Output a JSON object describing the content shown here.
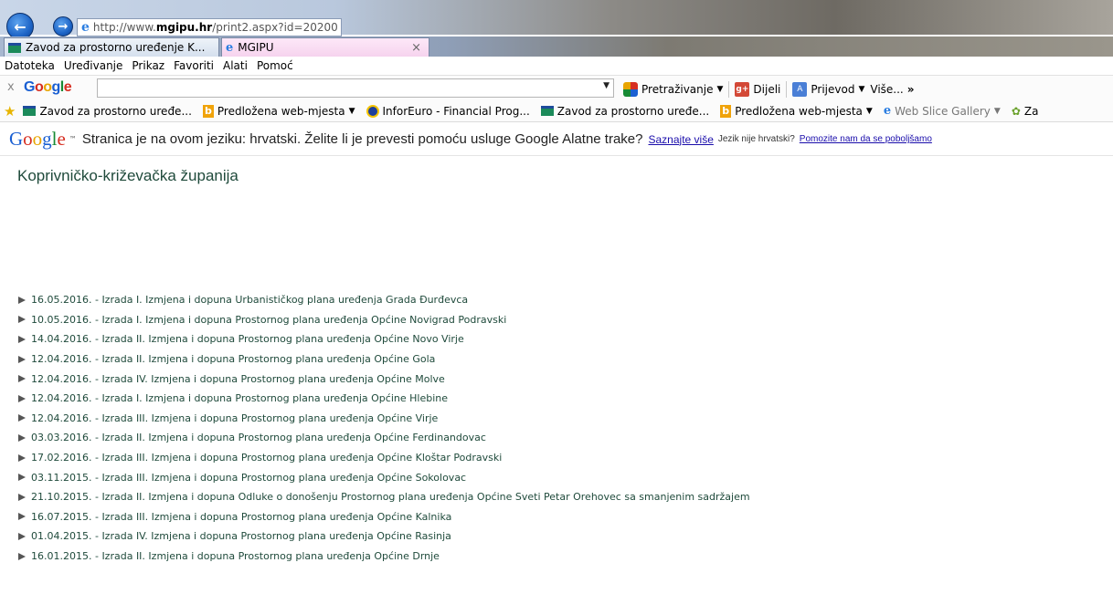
{
  "browser": {
    "url_prefix": "http://www.",
    "url_domain": "mgipu.hr",
    "url_path": "/print2.aspx?id=20200",
    "tabs": [
      {
        "label": "Zavod za prostorno uređenje K..."
      },
      {
        "label": "MGIPU"
      }
    ],
    "menu": [
      "Datoteka",
      "Uređivanje",
      "Prikaz",
      "Favoriti",
      "Alati",
      "Pomoć"
    ]
  },
  "google_toolbar": {
    "close": "x",
    "logo": [
      "G",
      "o",
      "o",
      "g",
      "l",
      "e"
    ],
    "search_value": "",
    "search_label": "Pretraživanje",
    "share_label": "Dijeli",
    "translate_label": "Prijevod",
    "more_label": "Više...",
    "overflow": "»"
  },
  "favorites": [
    {
      "label": "Zavod za prostorno uređe...",
      "icon": "green"
    },
    {
      "label": "Predložena web-mjesta",
      "icon": "bing",
      "dropdown": "▼"
    },
    {
      "label": "InforEuro - Financial Prog...",
      "icon": "euro"
    },
    {
      "label": "Zavod za prostorno uređe...",
      "icon": "green"
    },
    {
      "label": "Predložena web-mjesta",
      "icon": "bing",
      "dropdown": "▼"
    },
    {
      "label": "Web Slice Gallery",
      "icon": "web",
      "dropdown": "▼"
    },
    {
      "label": "Za",
      "icon": "plug"
    }
  ],
  "translate_bar": {
    "logo": [
      "G",
      "o",
      "o",
      "g",
      "l",
      "e"
    ],
    "tm": "™",
    "message": "Stranica je na ovom jeziku: hrvatski. Želite li je prevesti pomoću usluge Google Alatne trake?",
    "learn_more": "Saznajte više",
    "not_language": "Jezik nije hrvatski?",
    "help_link": "Pomozite nam da se poboljšamo"
  },
  "page": {
    "title": "Koprivničko-križevačka županija",
    "items": [
      "16.05.2016. - Izrada I. Izmjena i dopuna Urbanističkog plana uređenja Grada Đurđevca",
      "10.05.2016. - Izrada I. Izmjena i dopuna Prostornog plana uređenja Općine Novigrad Podravski",
      "14.04.2016. - Izrada II. Izmjena i dopuna Prostornog plana uređenja Općine Novo Virje",
      "12.04.2016. - Izrada II. Izmjena i dopuna Prostornog plana uređenja Općine Gola",
      "12.04.2016. - Izrada IV. Izmjena i dopuna Prostornog plana uređenja Općine Molve",
      "12.04.2016. - Izrada I. Izmjena i dopuna Prostornog plana uređenja Općine Hlebine",
      "12.04.2016. - Izrada III. Izmjena i dopuna Prostornog plana uređenja Općine Virje",
      "03.03.2016. - Izrada II. Izmjena i dopuna Prostornog plana uređenja Općine Ferdinandovac",
      "17.02.2016. - Izrada III. Izmjena i dopuna Prostornog plana uređenja Općine Kloštar Podravski",
      "03.11.2015. - Izrada III. Izmjena i dopuna Prostornog plana uređenja Općine Sokolovac",
      "21.10.2015. - Izrada II. Izmjena i dopuna Odluke o donošenju Prostornog plana uređenja Općine Sveti Petar Orehovec sa smanjenim sadržajem",
      "16.07.2015. - Izrada III. Izmjena i dopuna Prostornog plana uređenja Općine Kalnika",
      "01.04.2015. - Izrada IV. Izmjena i dopuna Prostornog plana uređenja Općine Rasinja",
      "16.01.2015. - Izrada II. Izmjena i dopuna Prostornog plana uređenja Općine Drnje"
    ]
  }
}
